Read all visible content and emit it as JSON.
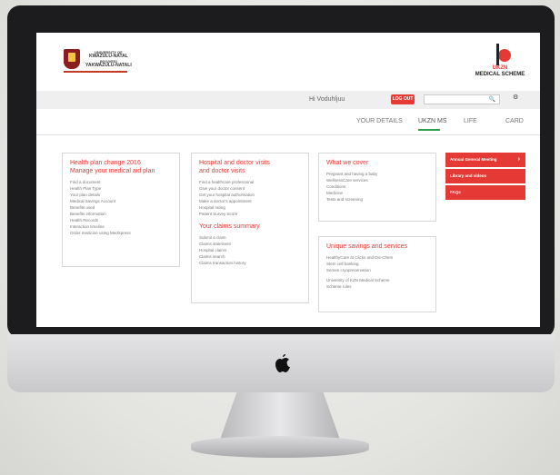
{
  "header": {
    "uni_line1": "UNIVERSITY OF",
    "uni_line2": "KWAZULU-NATAL",
    "uni_line3": "INYUVESI",
    "uni_line4": "YAKWAZULU-NATALI",
    "med_line1": "UKZN",
    "med_line2": "MEDICAL SCHEME"
  },
  "topbar": {
    "greeting": "Hi Voduhljuu",
    "logout_label": "LOG OUT",
    "search_placeholder": ""
  },
  "nav": {
    "items": [
      "YOUR DETAILS",
      "UKZN MS",
      "LIFE",
      "CARD"
    ]
  },
  "cards": {
    "plan": {
      "title1": "Health plan change 2016",
      "title2": "Manage your medical aid plan",
      "items": [
        "Find a document",
        "Health Plan Type",
        "Your plan details",
        "Medical Savings Account",
        "Benefits used",
        "Benefits information",
        "Health Records",
        "Interaction timeline",
        "Order medicine using MedXpress"
      ]
    },
    "hospital": {
      "title1": "Hospital and doctor visits",
      "title2": "and doctor visits",
      "items": [
        "Find a healthcare professional",
        "Give your doctor consent",
        "Get your hospital authorisation",
        "Make a doctor's appointment",
        "Hospital rating",
        "Patient Survey Score"
      ],
      "sub_title": "Your claims summary",
      "sub_items": [
        "Submit a claim",
        "Claims statement",
        "Hospital claims",
        "Claims search",
        "Claims transaction history"
      ]
    },
    "cover": {
      "title": "What we cover",
      "items": [
        "Pregnant and having a baby",
        "WellnessCare services",
        "Conditions",
        "Medicine",
        "Tests and screening"
      ]
    },
    "savings": {
      "title": "Unique savings and services",
      "items": [
        "HealthyCare at Clicks and Dis-Chem",
        "Stem cell banking",
        "Semen cryopreservation"
      ],
      "items2": [
        "University of KZN Medical Scheme",
        "Scheme rules"
      ]
    }
  },
  "buttons": [
    "Annual General Meeting",
    "Library and videos",
    "FAQs"
  ]
}
